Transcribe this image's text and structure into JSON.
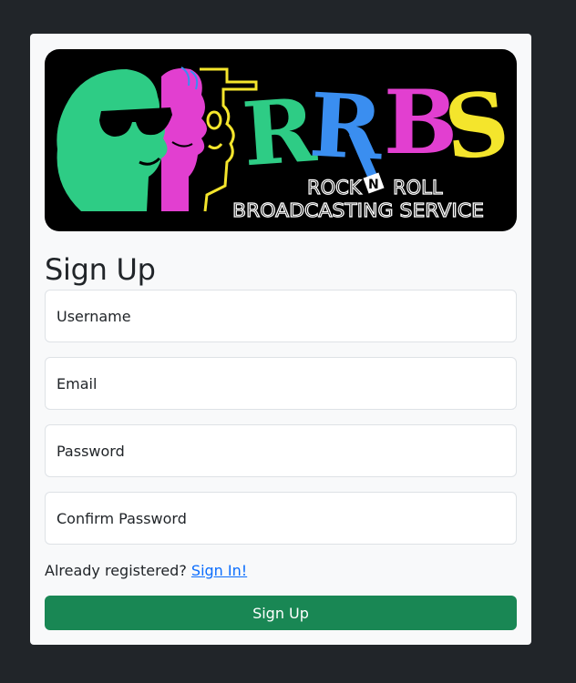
{
  "logo": {
    "letters": [
      "R",
      "R",
      "B",
      "S"
    ],
    "line1_left": "ROCK",
    "line1_mid": "N",
    "line1_right": "ROLL",
    "line2": "BROADCASTING SERVICE",
    "colors": {
      "green": "#2ecc85",
      "blue": "#3a8ef0",
      "magenta": "#e23fd0",
      "yellow": "#f4e52c",
      "background": "#000000"
    }
  },
  "form": {
    "title": "Sign Up",
    "username_placeholder": "Username",
    "email_placeholder": "Email",
    "password_placeholder": "Password",
    "confirm_placeholder": "Confirm Password",
    "already_text": "Already registered?",
    "signin_link": "Sign In!",
    "submit_label": "Sign Up"
  },
  "colors": {
    "page_bg": "#212529",
    "card_bg": "#f8f9fa",
    "link": "#0d6efd",
    "submit_bg": "#198754"
  }
}
